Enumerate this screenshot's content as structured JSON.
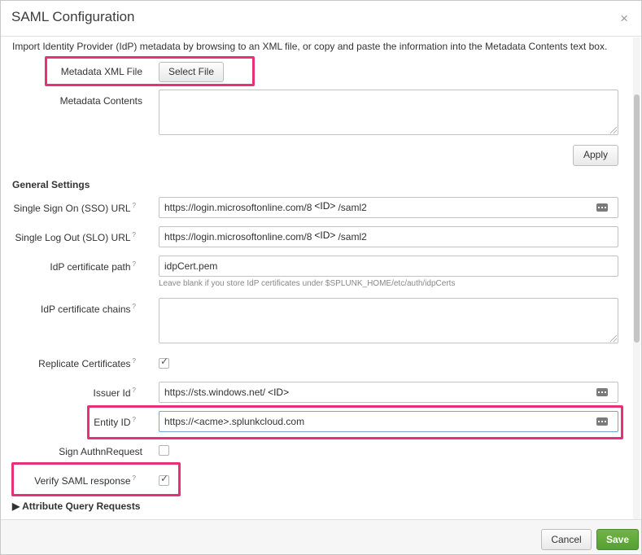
{
  "dialog": {
    "title": "SAML Configuration",
    "close_label": "×"
  },
  "intro_text": "Import Identity Provider (IdP) metadata by browsing to an XML file, or copy and paste the information into the Metadata Contents text box.",
  "metadata": {
    "file_label": "Metadata XML File",
    "select_file_label": "Select File",
    "contents_label": "Metadata Contents",
    "contents_value": "",
    "apply_label": "Apply"
  },
  "general": {
    "heading": "General Settings",
    "help_mark": "?",
    "sso_label": "Single Sign On (SSO) URL",
    "sso_prefix": "https://login.microsoftonline.com/8",
    "sso_token": "<ID>",
    "sso_suffix": "/saml2",
    "slo_label": "Single Log Out (SLO) URL",
    "slo_prefix": "https://login.microsoftonline.com/8",
    "slo_token": "<ID>",
    "slo_suffix": "/saml2",
    "cert_path_label": "IdP certificate path",
    "cert_path_value": "idpCert.pem",
    "cert_path_hint": "Leave blank if you store IdP certificates under $SPLUNK_HOME/etc/auth/idpCerts",
    "cert_chains_label": "IdP certificate chains",
    "cert_chains_value": "",
    "replicate_label": "Replicate Certificates",
    "replicate_checked": true,
    "issuer_label": "Issuer Id",
    "issuer_prefix": "https://sts.windows.net/",
    "issuer_token": "<ID>",
    "entity_label": "Entity ID",
    "entity_value": "https://<acme>.splunkcloud.com",
    "sign_authn_label": "Sign AuthnRequest",
    "sign_authn_checked": false,
    "verify_label": "Verify SAML response",
    "verify_checked": true,
    "check_mark": "✓"
  },
  "attribute_query": {
    "label": "Attribute Query Requests",
    "arrow": "▶"
  },
  "footer": {
    "cancel_label": "Cancel",
    "save_label": "Save"
  },
  "colors": {
    "highlight": "#e8307a",
    "save": "#5ca536"
  },
  "icons": [
    "close-icon",
    "password-key-icon",
    "resize-grip-icon",
    "checkmark-icon",
    "expand-arrow-icon"
  ]
}
